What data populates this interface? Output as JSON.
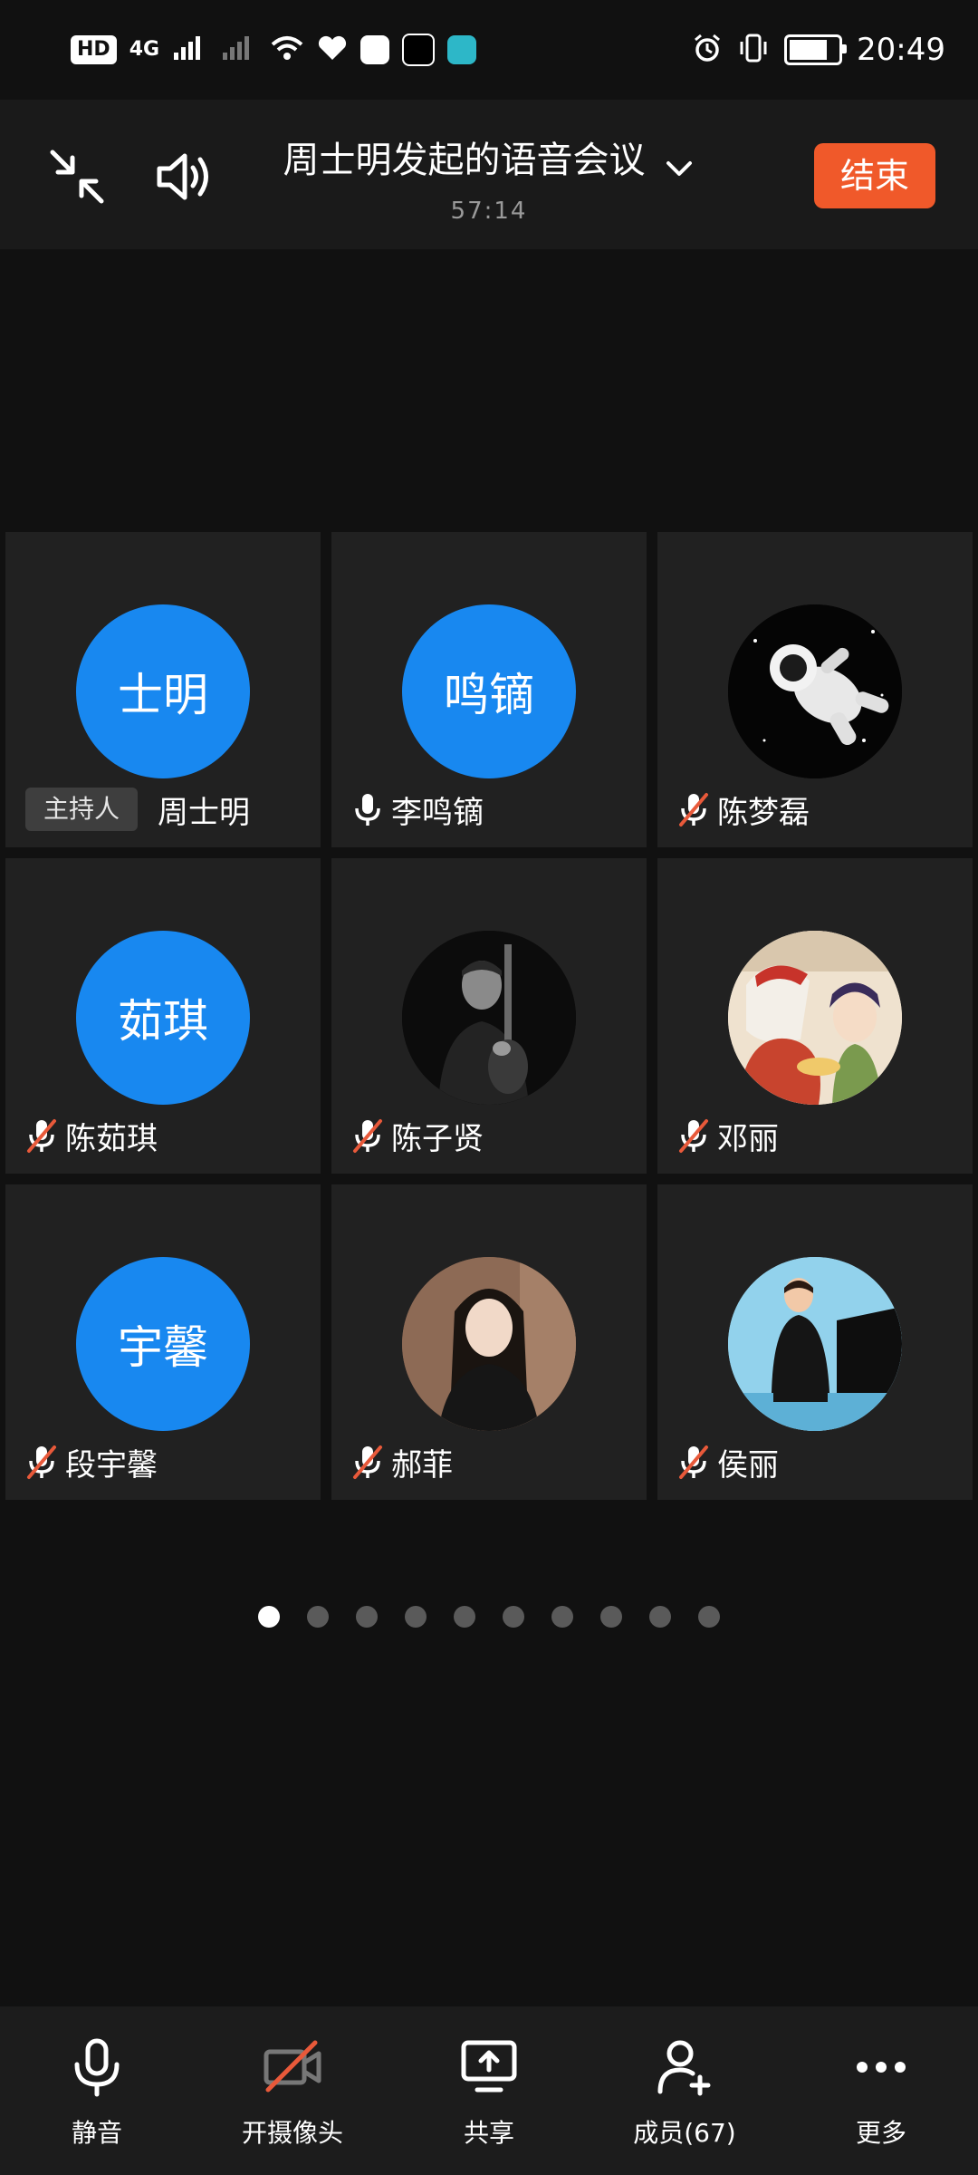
{
  "status_bar": {
    "network_hd": "HD",
    "network_type": "4G",
    "time": "20:49"
  },
  "header": {
    "title": "周士明发起的语音会议",
    "timer": "57:14",
    "end_label": "结束"
  },
  "participants": [
    {
      "name": "周士明",
      "avatar_text": "士明",
      "avatar_type": "initials",
      "role_badge": "主持人",
      "mic": "none"
    },
    {
      "name": "李鸣镝",
      "avatar_text": "鸣镝",
      "avatar_type": "initials",
      "mic": "on"
    },
    {
      "name": "陈梦磊",
      "avatar_type": "photo",
      "avatar_icon": "astronaut-photo",
      "mic": "muted"
    },
    {
      "name": "陈茹琪",
      "avatar_text": "茹琪",
      "avatar_type": "initials",
      "mic": "muted"
    },
    {
      "name": "陈子贤",
      "avatar_type": "photo",
      "avatar_icon": "man-with-violin-photo",
      "mic": "muted"
    },
    {
      "name": "邓丽",
      "avatar_type": "photo",
      "avatar_icon": "anime-illustration-photo",
      "mic": "muted"
    },
    {
      "name": "段宇馨",
      "avatar_text": "宇馨",
      "avatar_type": "initials",
      "mic": "muted"
    },
    {
      "name": "郝菲",
      "avatar_type": "photo",
      "avatar_icon": "woman-portrait-photo",
      "mic": "muted"
    },
    {
      "name": "侯丽",
      "avatar_type": "photo",
      "avatar_icon": "woman-at-piano-photo",
      "mic": "muted"
    }
  ],
  "pagination": {
    "total_pages": 10,
    "current_page": 1
  },
  "toolbar": {
    "mute_label": "静音",
    "camera_label": "开摄像头",
    "share_label": "共享",
    "members_label": "成员(67)",
    "more_label": "更多"
  },
  "colors": {
    "accent_blue": "#1888f0",
    "end_button": "#f0592a",
    "muted_slash": "#e8593a",
    "background": "#111111",
    "tile": "#212121"
  }
}
